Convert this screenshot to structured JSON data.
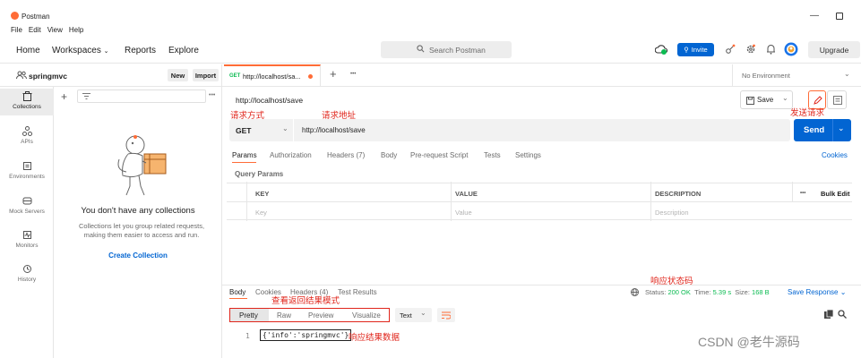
{
  "titlebar": {
    "app_name": "Postman",
    "menu": [
      "File",
      "Edit",
      "View",
      "Help"
    ],
    "minimize": "—"
  },
  "header": {
    "home": "Home",
    "workspaces": "Workspaces",
    "reports": "Reports",
    "explore": "Explore",
    "search_placeholder": "Search Postman",
    "invite": "Invite",
    "upgrade": "Upgrade"
  },
  "workspace": {
    "name": "springmvc",
    "new": "New",
    "import": "Import"
  },
  "sidebar": {
    "items": [
      {
        "label": "Collections",
        "icon": "trash-can-icon"
      },
      {
        "label": "APIs",
        "icon": "api-icon"
      },
      {
        "label": "Environments",
        "icon": "environment-icon"
      },
      {
        "label": "Mock Servers",
        "icon": "mock-server-icon"
      },
      {
        "label": "Monitors",
        "icon": "monitor-icon"
      },
      {
        "label": "History",
        "icon": "history-icon"
      }
    ]
  },
  "collections_panel": {
    "empty_title": "You don't have any collections",
    "empty_desc": "Collections let you group related requests, making them easier to access and run.",
    "create_label": "Create Collection"
  },
  "tabs": {
    "active": {
      "method": "GET",
      "title": "http://localhost/sa..."
    },
    "add": "+",
    "more": "•••",
    "environment": "No Environment"
  },
  "request": {
    "name": "http://localhost/save",
    "save": "Save",
    "method": "GET",
    "url": "http://localhost/save",
    "send": "Send",
    "tabs": [
      {
        "label": "Params"
      },
      {
        "label": "Authorization"
      },
      {
        "label": "Headers (7)"
      },
      {
        "label": "Body"
      },
      {
        "label": "Pre-request Script"
      },
      {
        "label": "Tests"
      },
      {
        "label": "Settings"
      }
    ],
    "cookies": "Cookies",
    "query_params_label": "Query Params",
    "table": {
      "headers": [
        "KEY",
        "VALUE",
        "DESCRIPTION"
      ],
      "placeholders": [
        "Key",
        "Value",
        "Description"
      ],
      "more": "•••",
      "bulk_edit": "Bulk Edit"
    }
  },
  "response": {
    "tabs": [
      "Body",
      "Cookies",
      "Headers (4)",
      "Test Results"
    ],
    "status_label": "Status:",
    "status": "200 OK",
    "time_label": "Time:",
    "time": "5.39 s",
    "size_label": "Size:",
    "size": "168 B",
    "save_response": "Save Response",
    "formats": [
      "Pretty",
      "Raw",
      "Preview",
      "Visualize"
    ],
    "lang": "Text",
    "line_no": "1",
    "body": "{'info':'springmvc'}"
  },
  "annotations": {
    "method": "请求方式",
    "address": "请求地址",
    "send": "发送请求",
    "status": "响应状态码",
    "format": "查看返回结果模式",
    "data": "响应结果数据"
  },
  "watermark": "CSDN @老牛源码",
  "colors": {
    "accent": "#ff6c37",
    "primary": "#0265d2",
    "annotation": "#e0251b",
    "status_ok": "#0cbb52"
  }
}
